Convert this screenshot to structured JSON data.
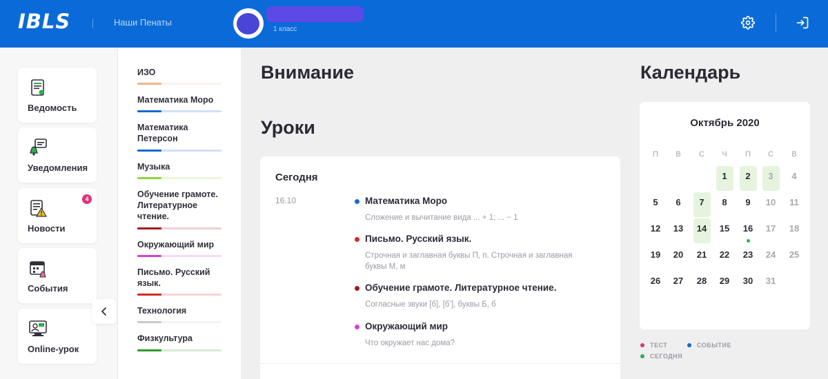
{
  "header": {
    "logo": "IBLS",
    "school": "Наши Пенаты",
    "grade": "1 класс"
  },
  "nav": [
    {
      "label": "Ведомость",
      "icon": "gradebook-icon"
    },
    {
      "label": "Уведомления",
      "icon": "notifications-icon"
    },
    {
      "label": "Новости",
      "icon": "news-icon",
      "badge": "4"
    },
    {
      "label": "События",
      "icon": "events-calendar-icon"
    },
    {
      "label": "Online-урок",
      "icon": "online-lesson-icon"
    }
  ],
  "subjects": [
    {
      "name": "ИЗО",
      "color": "#f2b48a"
    },
    {
      "name": "Математика Моро",
      "color": "#1668d6"
    },
    {
      "name": "Математика Петерсон",
      "color": "#1668d6"
    },
    {
      "name": "Музыка",
      "color": "#8fd63a"
    },
    {
      "name": "Обучение грамоте. Литературное чтение.",
      "color": "#a0191e"
    },
    {
      "name": "Окружающий мир",
      "color": "#d63fd6"
    },
    {
      "name": "Письмо. Русский язык.",
      "color": "#d62828"
    },
    {
      "name": "Технология",
      "color": "#c9c9c9"
    },
    {
      "name": "Физкультура",
      "color": "#2f9a2f"
    }
  ],
  "main": {
    "attention_title": "Внимание",
    "lessons_title": "Уроки",
    "today_label": "Сегодня",
    "date": "16.10",
    "lessons": [
      {
        "title": "Математика Моро",
        "desc": "Сложение и вычитание вида ... + 1; ... − 1",
        "color": "#1668d6"
      },
      {
        "title": "Письмо. Русский язык.",
        "desc": "Строчная и заглавная буквы П, п. Строчная и заглавная буквы М, м",
        "color": "#d62828"
      },
      {
        "title": "Обучение грамоте. Литературное чтение.",
        "desc": "Согласные звуки [б], [б’], буквы Б, б",
        "color": "#a0191e"
      },
      {
        "title": "Окружающий мир",
        "desc": "Что окружает нас дома?",
        "color": "#d63fd6"
      }
    ]
  },
  "calendar": {
    "title": "Календарь",
    "month": "Октябрь 2020",
    "weekdays": [
      "П",
      "В",
      "С",
      "Ч",
      "П",
      "С",
      "В"
    ],
    "weeks": [
      [
        null,
        null,
        null,
        1,
        2,
        3,
        4
      ],
      [
        5,
        6,
        7,
        8,
        9,
        10,
        11
      ],
      [
        12,
        13,
        14,
        15,
        16,
        17,
        18
      ],
      [
        19,
        20,
        21,
        22,
        23,
        24,
        25
      ],
      [
        26,
        27,
        28,
        29,
        30,
        31,
        null
      ]
    ],
    "highlighted_days": [
      1,
      2,
      3,
      7,
      14
    ],
    "today": 16,
    "faded_days": [
      3,
      4,
      10,
      11,
      17,
      18,
      24,
      25,
      31
    ],
    "legend": [
      {
        "label": "ТЕСТ",
        "color": "#e0337a"
      },
      {
        "label": "СОБЫТИЕ",
        "color": "#1668d6"
      },
      {
        "label": "СЕГОДНЯ",
        "color": "#2bb04b"
      }
    ]
  }
}
